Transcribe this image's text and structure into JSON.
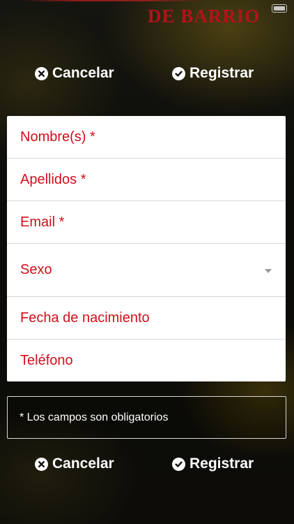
{
  "header": {
    "logo_text": "DE BARRIO"
  },
  "actions": {
    "cancel_label": "Cancelar",
    "register_label": "Registrar"
  },
  "form": {
    "fields": [
      {
        "label": "Nombre(s) *"
      },
      {
        "label": "Apellidos *"
      },
      {
        "label": "Email *"
      },
      {
        "label": "Sexo"
      },
      {
        "label": "Fecha de nacimiento"
      },
      {
        "label": "Teléfono"
      }
    ]
  },
  "note": {
    "text": "* Los campos son obligatorios"
  },
  "icons": {
    "cancel": "close-circle-icon",
    "register": "check-circle-icon",
    "dropdown": "chevron-down-icon"
  },
  "colors": {
    "accent": "#d0101a",
    "logo": "#b3121a",
    "background": "#0c0c08",
    "form_background": "#ffffff"
  }
}
